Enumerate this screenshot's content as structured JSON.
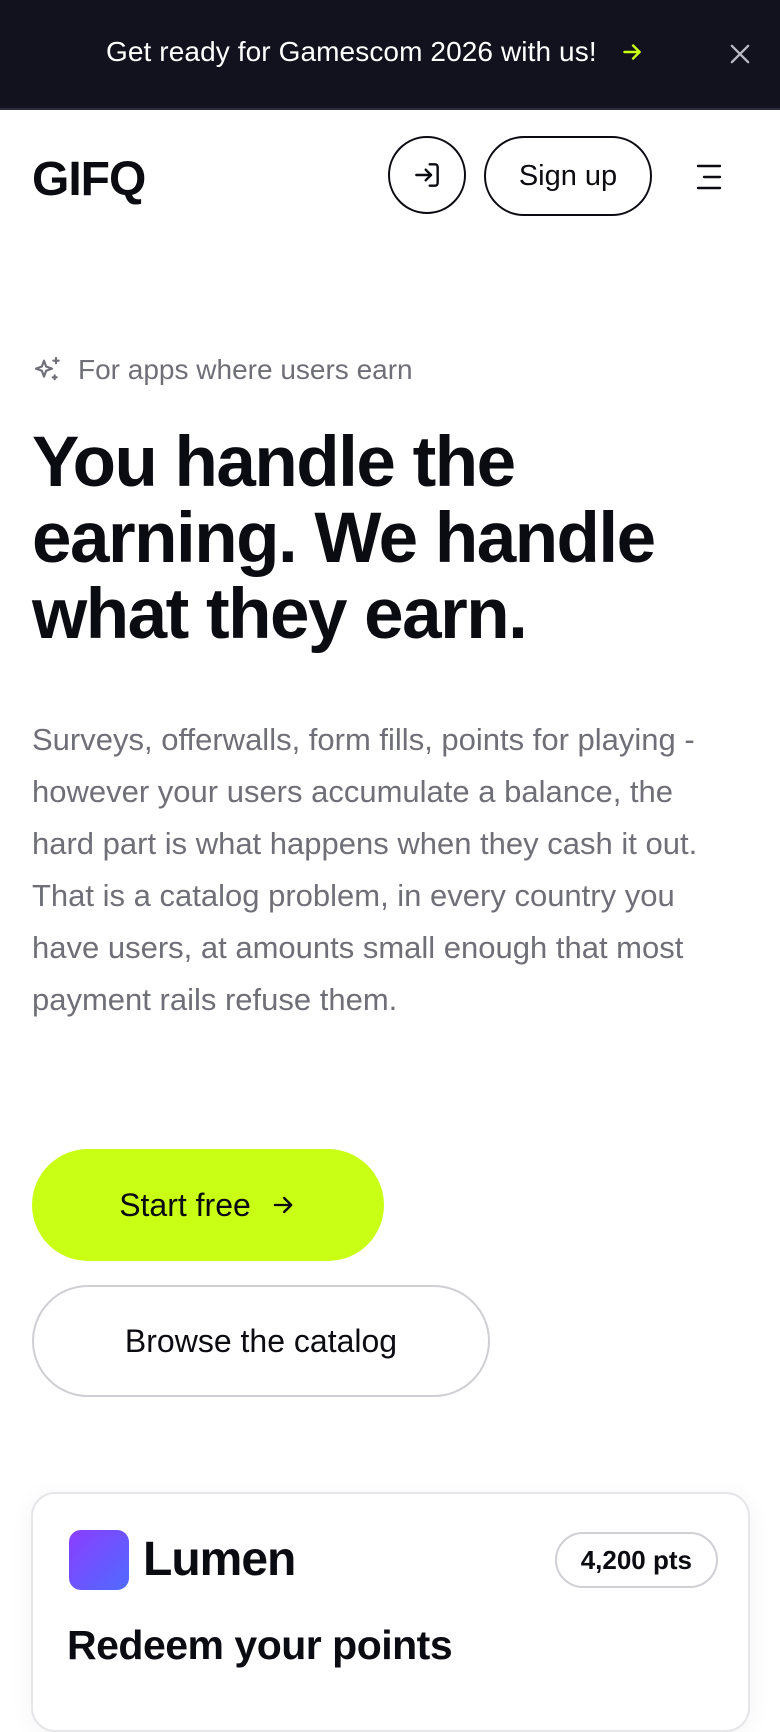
{
  "announcement": {
    "text": "Get ready for Gamescom 2026 with us!",
    "accent_color": "#c8ff14",
    "arrow_icon": "arrow-right-icon",
    "close_icon": "close-icon"
  },
  "nav": {
    "logo": "GIFQ",
    "login_icon": "login-icon",
    "signup_label": "Sign up",
    "menu_icon": "hamburger-menu-icon"
  },
  "hero": {
    "eyebrow_icon": "sparkles-icon",
    "eyebrow": "For apps where users earn",
    "headline": "You handle the earning. We handle what they earn.",
    "lead": "Surveys, offerwalls, form fills, points for playing - however your users accumulate a balance, the hard part is what happens when they cash it out. That is a catalog problem, in every country you have users, at amounts small enough that most payment rails refuse them.",
    "primary_cta": "Start free",
    "primary_color": "#c8ff14",
    "secondary_cta": "Browse the catalog"
  },
  "preview_card": {
    "brand_name": "Lumen",
    "points": "4,200 pts",
    "title": "Redeem your points"
  }
}
